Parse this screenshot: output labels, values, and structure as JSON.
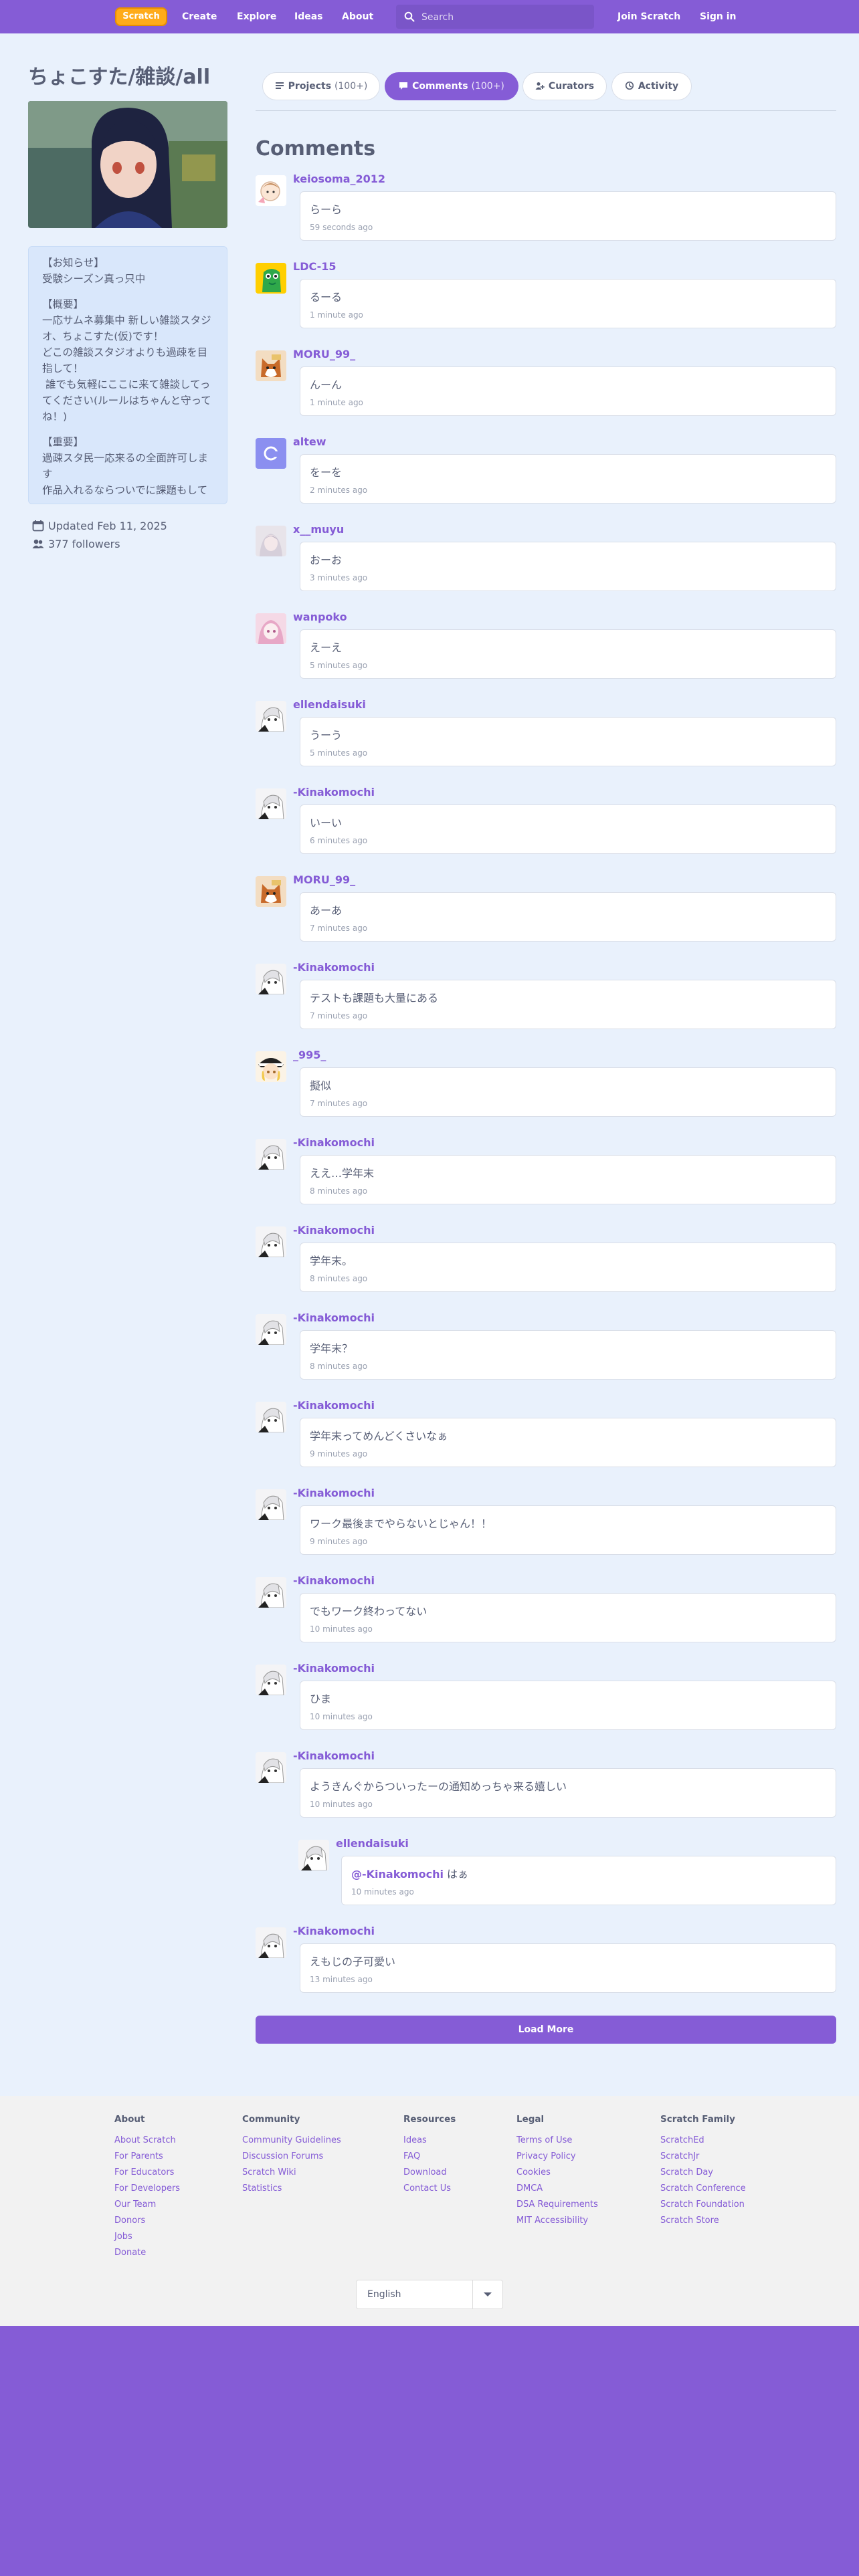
{
  "nav": {
    "logo": "Scratch",
    "create": "Create",
    "explore": "Explore",
    "ideas": "Ideas",
    "about": "About",
    "search_placeholder": "Search",
    "join": "Join Scratch",
    "signin": "Sign in"
  },
  "studio": {
    "title": "ちょこすた/雑談/all",
    "description": [
      "【お知らせ】\n受験シーズン真っ只中",
      "【概要】\n一応サムネ募集中 新しい雑談スタジオ、ちょこすた(仮)です！\nどこの雑談スタジオよりも過疎を目指して！\n 誰でも気軽にここに来て雑談してってください(ルールはちゃんと守ってね！)",
      "【重要】\n過疎スタ民一応来るの全面許可します\n作品入れるならついでに課題もして"
    ],
    "updated": "Updated Feb 11, 2025",
    "followers": "377 followers"
  },
  "tabs": [
    {
      "label": "Projects",
      "count": "(100+)"
    },
    {
      "label": "Comments",
      "count": "(100+)"
    },
    {
      "label": "Curators",
      "count": ""
    },
    {
      "label": "Activity",
      "count": ""
    }
  ],
  "comments_title": "Comments",
  "comments": [
    {
      "user": "keiosoma_2012",
      "text": "らーら",
      "time": "59 seconds ago"
    },
    {
      "user": "LDC-15",
      "text": "るーる",
      "time": "1 minute ago"
    },
    {
      "user": "MORU_99_",
      "text": "んーん",
      "time": "1 minute ago"
    },
    {
      "user": "altew",
      "text": "をーを",
      "time": "2 minutes ago"
    },
    {
      "user": "x__muyu",
      "text": "おーお",
      "time": "3 minutes ago"
    },
    {
      "user": "wanpoko",
      "text": "えーえ",
      "time": "5 minutes ago"
    },
    {
      "user": "ellendaisuki",
      "text": "うーう",
      "time": "5 minutes ago"
    },
    {
      "user": "-Kinakomochi",
      "text": "いーい",
      "time": "6 minutes ago"
    },
    {
      "user": "MORU_99_",
      "text": "あーあ",
      "time": "7 minutes ago"
    },
    {
      "user": "-Kinakomochi",
      "text": "テストも課題も大量にある",
      "time": "7 minutes ago"
    },
    {
      "user": "_995_",
      "text": "擬似",
      "time": "7 minutes ago"
    },
    {
      "user": "-Kinakomochi",
      "text": "ええ…学年末",
      "time": "8 minutes ago"
    },
    {
      "user": "-Kinakomochi",
      "text": "学年末。",
      "time": "8 minutes ago"
    },
    {
      "user": "-Kinakomochi",
      "text": "学年末？",
      "time": "8 minutes ago"
    },
    {
      "user": "-Kinakomochi",
      "text": "学年末ってめんどくさいなぁ",
      "time": "9 minutes ago"
    },
    {
      "user": "-Kinakomochi",
      "text": "ワーク最後までやらないとじゃん！！",
      "time": "9 minutes ago"
    },
    {
      "user": "-Kinakomochi",
      "text": "でもワーク終わってない",
      "time": "10 minutes ago"
    },
    {
      "user": "-Kinakomochi",
      "text": "ひま",
      "time": "10 minutes ago"
    },
    {
      "user": "-Kinakomochi",
      "text": "ようきんぐからついったーの通知めっちゃ来る嬉しい",
      "time": "10 minutes ago"
    }
  ],
  "reply": {
    "user": "ellendaisuki",
    "mention": "@-Kinakomochi",
    "text": " はぁ",
    "time": "10 minutes ago"
  },
  "last_comment": {
    "user": "-Kinakomochi",
    "text": "えもじの子可愛い",
    "time": "13 minutes ago"
  },
  "load_more": "Load More",
  "footer": {
    "columns": [
      {
        "title": "About",
        "links": [
          "About Scratch",
          "For Parents",
          "For Educators",
          "For Developers",
          "Our Team",
          "Donors",
          "Jobs",
          "Donate"
        ]
      },
      {
        "title": "Community",
        "links": [
          "Community Guidelines",
          "Discussion Forums",
          "Scratch Wiki",
          "Statistics"
        ]
      },
      {
        "title": "Resources",
        "links": [
          "Ideas",
          "FAQ",
          "Download",
          "Contact Us"
        ]
      },
      {
        "title": "Legal",
        "links": [
          "Terms of Use",
          "Privacy Policy",
          "Cookies",
          "DMCA",
          "DSA Requirements",
          "MIT Accessibility"
        ]
      },
      {
        "title": "Scratch Family",
        "links": [
          "ScratchEd",
          "ScratchJr",
          "Scratch Day",
          "Scratch Conference",
          "Scratch Foundation",
          "Scratch Store"
        ]
      }
    ],
    "language": "English"
  },
  "colors": {
    "brand": "#855cd6",
    "page_bg": "#e9f1fc",
    "text": "#575e75",
    "logo": "#ffab19"
  }
}
